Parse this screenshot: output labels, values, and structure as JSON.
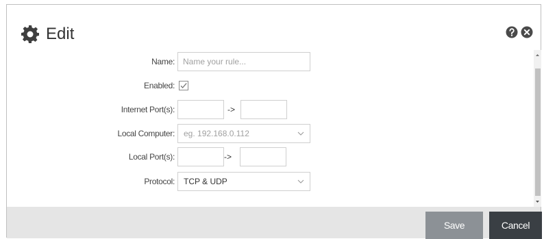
{
  "dialog": {
    "title": "Edit",
    "icons": {
      "title": "gear-icon",
      "help": "help-icon",
      "close": "close-icon"
    }
  },
  "form": {
    "name": {
      "label": "Name:",
      "value": "",
      "placeholder": "Name your rule..."
    },
    "enabled": {
      "label": "Enabled:",
      "checked": true
    },
    "internet_ports": {
      "label": "Internet Port(s):",
      "from": "",
      "separator": "->",
      "to": ""
    },
    "local_computer": {
      "label": "Local Computer:",
      "value": "",
      "placeholder": "eg. 192.168.0.112"
    },
    "local_ports": {
      "label": "Local Port(s):",
      "from": "",
      "separator": "->",
      "to": ""
    },
    "protocol": {
      "label": "Protocol:",
      "selected": "TCP & UDP"
    }
  },
  "footer": {
    "save_label": "Save",
    "cancel_label": "Cancel"
  },
  "colors": {
    "save_button": "#8c9196",
    "cancel_button": "#3a3f44",
    "footer_bg": "#e5e5e5",
    "scroll_thumb": "#c1c1c1",
    "input_border": "#cfcfcf"
  }
}
